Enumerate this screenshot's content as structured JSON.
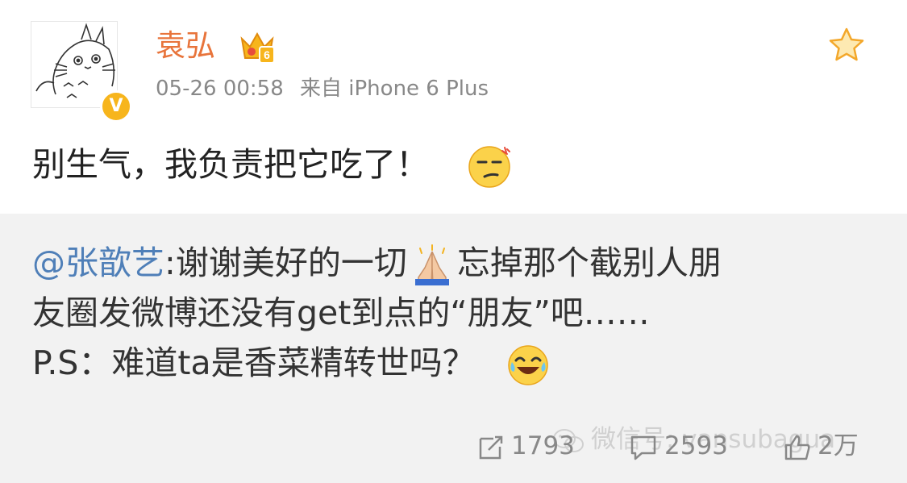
{
  "post": {
    "username": "袁弘",
    "vip_level": "6",
    "verified_mark": "V",
    "time": "05-26 00:58",
    "source": "来自 iPhone 6 Plus",
    "text": "别生气，我负责把它吃了！",
    "text_emoji": "smirking-face-emoji"
  },
  "repost": {
    "mention": "@张歆艺",
    "line1_a": ":谢谢美好的一切",
    "line1_emoji": "folded-hands-emoji",
    "line1_b": "忘掉那个截别人朋",
    "line2": "友圈发微博还没有get到点的“朋友”吧……",
    "line3": "P.S：难道ta是香菜精转世吗？",
    "line3_emoji": "tears-of-joy-emoji"
  },
  "actions": {
    "repost_count": "1793",
    "comment_count": "2593",
    "like_count": "2万"
  },
  "watermark": {
    "text": "微信号: vansubagua",
    "icon": "wechat-icon"
  },
  "colors": {
    "username": "#e8743b",
    "mention": "#4f7fb8",
    "badge": "#f7b51c",
    "meta": "#888888",
    "repost_bg": "#f2f2f2"
  }
}
